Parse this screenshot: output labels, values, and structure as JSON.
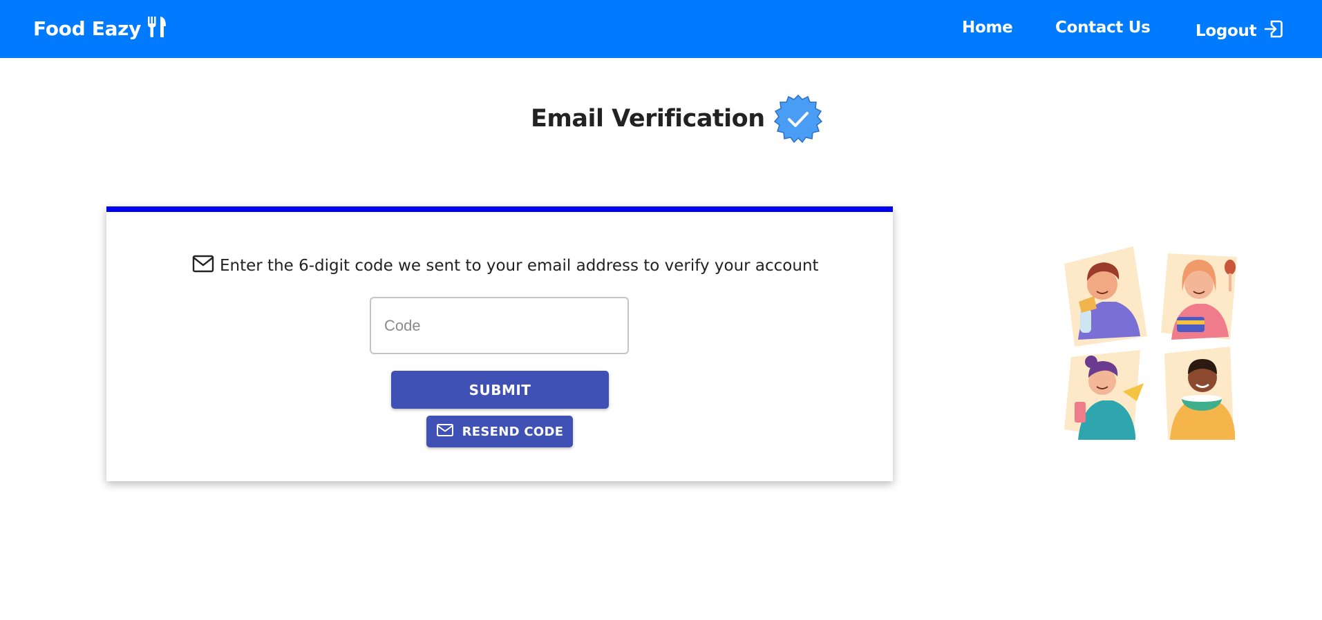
{
  "navbar": {
    "brand": "Food Eazy",
    "links": {
      "home": "Home",
      "contact": "Contact Us",
      "logout": "Logout"
    }
  },
  "page": {
    "title": "Email Verification"
  },
  "verification_card": {
    "instruction": "Enter the 6-digit code we sent to your email address to verify your account",
    "code_placeholder": "Code",
    "code_value": "",
    "submit_label": "SUBMIT",
    "resend_label": "RESEND CODE"
  },
  "icons": {
    "brand": "fork-knife-icon",
    "logout": "logout-icon",
    "verified": "verified-badge-icon",
    "instruction": "envelope-icon",
    "resend": "envelope-icon"
  },
  "colors": {
    "navbar": "#007bff",
    "card_top_border": "#0000ee",
    "button": "#3f51b5",
    "badge": "#4a9df5"
  }
}
